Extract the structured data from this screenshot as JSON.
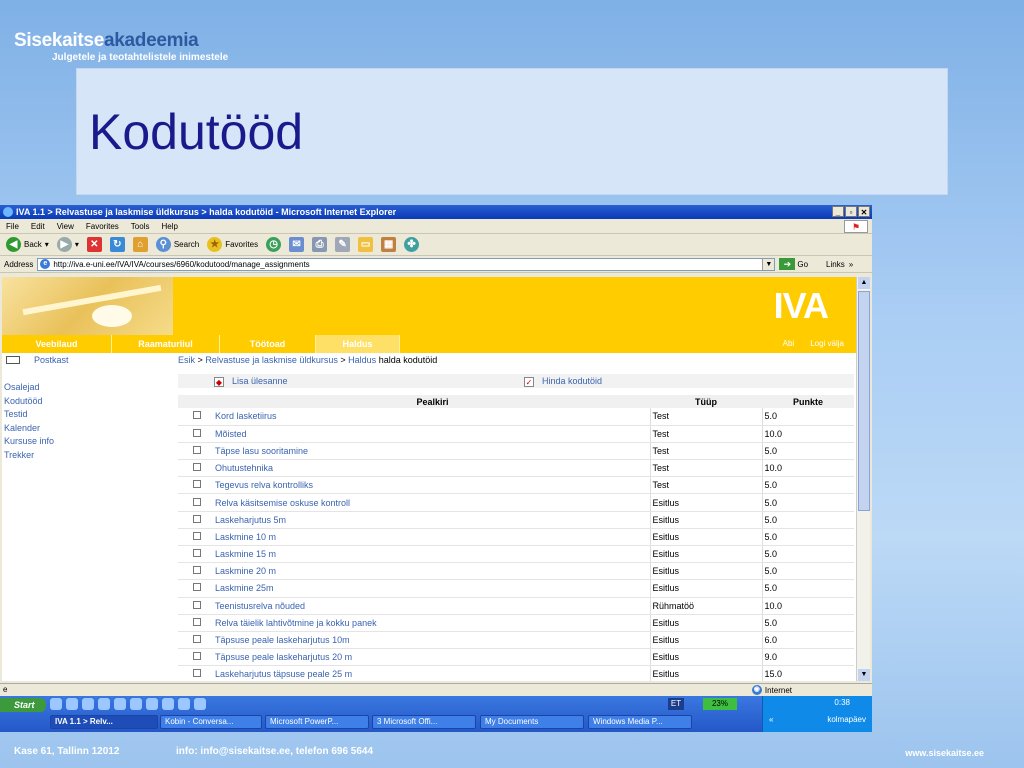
{
  "slide": {
    "logo_main": "Sisekaitse",
    "logo_accent": "akadeemia",
    "logo_sub": "Julgetele ja teotahtelistele inimestele",
    "title": "Kodutööd",
    "footer_address": "Kase 61, Tallinn 12012",
    "footer_contact": "info: info@sisekaitse.ee, telefon 696 5644",
    "footer_web": "www.sisekaitse.ee"
  },
  "window": {
    "title": "IVA 1.1 > Relvastuse ja laskmise üldkursus > halda kodutöid - Microsoft Internet Explorer",
    "menu": [
      "File",
      "Edit",
      "View",
      "Favorites",
      "Tools",
      "Help"
    ],
    "toolbar": {
      "back": "Back",
      "search": "Search",
      "favorites": "Favorites"
    },
    "address_label": "Address",
    "address_value": "http://iva.e-uni.ee/IVA/IVA/courses/6960/kodutood/manage_assignments",
    "go": "Go",
    "links": "Links",
    "status_zone": "Internet"
  },
  "page": {
    "brand": "IVA",
    "nav_tabs": [
      "Veebilaud",
      "Raamaturiiul",
      "Töötoad",
      "Haldus"
    ],
    "nav_right": [
      "Abi",
      "Logi välja"
    ],
    "postkast": "Postkast",
    "left_links": [
      "Osalejad",
      "Kodutööd",
      "Testid",
      "Kalender",
      "Kursuse info",
      "Trekker"
    ],
    "breadcrumb": {
      "items": [
        "Esik",
        "Relvastuse ja laskmise üldkursus",
        "Haldus"
      ],
      "separator": ">",
      "current": "halda kodutöid"
    },
    "actions": {
      "add": "Lisa ülesanne",
      "grade": "Hinda kodutöid"
    },
    "table": {
      "headers": [
        "Pealkiri",
        "Tüüp",
        "Punkte"
      ],
      "rows": [
        {
          "title": "Kord lasketiirus",
          "type": "Test",
          "points": "5.0"
        },
        {
          "title": "Mõisted",
          "type": "Test",
          "points": "10.0"
        },
        {
          "title": "Täpse lasu sooritamine",
          "type": "Test",
          "points": "5.0"
        },
        {
          "title": "Ohutustehnika",
          "type": "Test",
          "points": "10.0"
        },
        {
          "title": "Tegevus relva kontrolliks",
          "type": "Test",
          "points": "5.0"
        },
        {
          "title": "Relva käsitsemise oskuse kontroll",
          "type": "Esitlus",
          "points": "5.0"
        },
        {
          "title": "Laskeharjutus 5m",
          "type": "Esitlus",
          "points": "5.0"
        },
        {
          "title": "Laskmine 10 m",
          "type": "Esitlus",
          "points": "5.0"
        },
        {
          "title": "Laskmine 15 m",
          "type": "Esitlus",
          "points": "5.0"
        },
        {
          "title": "Laskmine 20 m",
          "type": "Esitlus",
          "points": "5.0"
        },
        {
          "title": "Laskmine 25m",
          "type": "Esitlus",
          "points": "5.0"
        },
        {
          "title": "Teenistusrelva nõuded",
          "type": "Rühmatöö",
          "points": "10.0"
        },
        {
          "title": "Relva täielik lahtivõtmine ja kokku panek",
          "type": "Esitlus",
          "points": "5.0"
        },
        {
          "title": "Täpsuse peale laskeharjutus 10m",
          "type": "Esitlus",
          "points": "6.0"
        },
        {
          "title": "Täpsuse peale laskeharjutus 20 m",
          "type": "Esitlus",
          "points": "9.0"
        },
        {
          "title": "Laskeharjutus täpsuse peale 25 m",
          "type": "Esitlus",
          "points": "15.0"
        }
      ]
    }
  },
  "taskbar": {
    "start": "Start",
    "tasks": [
      "IVA 1.1 > Relv...",
      "Kobin - Conversa...",
      "Microsoft PowerP...",
      "3 Microsoft Offi...",
      "My Documents",
      "Windows Media P..."
    ],
    "lang": "ET",
    "battery": "23%",
    "time": "0:38",
    "day": "kolmapäev"
  },
  "colors": {
    "accent": "#ffcc00",
    "link": "#3a63b0",
    "title": "#1a1a8c"
  }
}
